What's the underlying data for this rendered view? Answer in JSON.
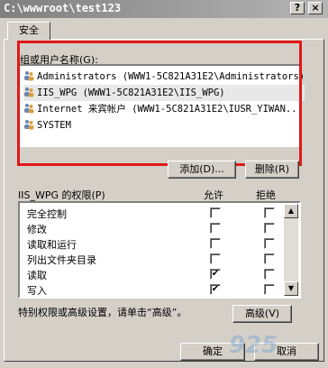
{
  "window": {
    "title": "C:\\wwwroot\\test123",
    "help_label": "?",
    "close_label": "×"
  },
  "tabs": [
    {
      "label": "安全"
    }
  ],
  "users": {
    "label": "组或用户名称(G):",
    "items": [
      {
        "text": "Administrators (WWW1-5C821A31E2\\Administrators)",
        "selected": false
      },
      {
        "text": "IIS_WPG (WWW1-5C821A31E2\\IIS_WPG)",
        "selected": true
      },
      {
        "text": "Internet 来宾帐户 (WWW1-5C821A31E2\\IUSR_YIWAN...",
        "selected": false
      },
      {
        "text": "SYSTEM",
        "selected": false
      }
    ],
    "add_label": "添加(D)...",
    "remove_label": "删除(R)"
  },
  "permissions": {
    "title": "IIS_WPG 的权限(P)",
    "allow_header": "允许",
    "deny_header": "拒绝",
    "rows": [
      {
        "label": "完全控制",
        "allow": false,
        "deny": false
      },
      {
        "label": "修改",
        "allow": false,
        "deny": false
      },
      {
        "label": "读取和运行",
        "allow": false,
        "deny": false
      },
      {
        "label": "列出文件夹目录",
        "allow": false,
        "deny": false
      },
      {
        "label": "读取",
        "allow": true,
        "deny": false
      },
      {
        "label": "写入",
        "allow": true,
        "deny": false
      }
    ]
  },
  "advanced": {
    "hint": "特别权限或高级设置，请单击“高级”。",
    "button_label": "高级(V)"
  },
  "footer": {
    "ok_label": "确定",
    "cancel_label": "取消"
  },
  "watermark": "925",
  "accent_color": "#e01818"
}
